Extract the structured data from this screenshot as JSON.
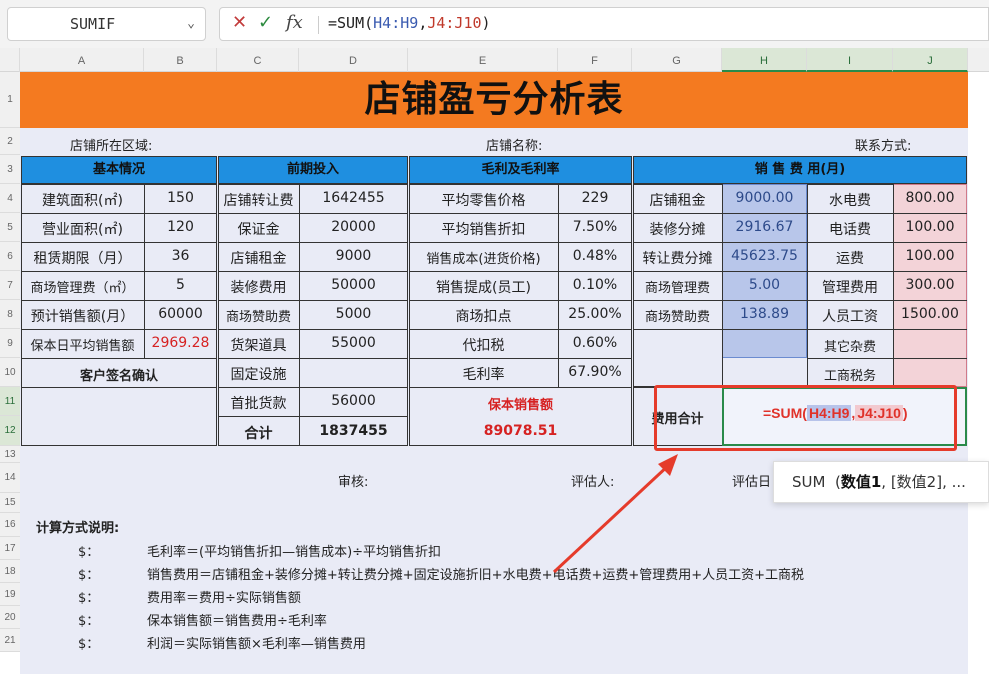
{
  "formula_bar": {
    "name_box": "SUMIF",
    "cancel_icon": "✕",
    "confirm_icon": "✓",
    "fx_label": "fx",
    "formula_prefix": "=SUM(",
    "formula_ref1": "H4:H9",
    "formula_comma": ",",
    "formula_ref2": "J4:J10",
    "formula_suffix": ")"
  },
  "columns": [
    "A",
    "B",
    "C",
    "D",
    "E",
    "F",
    "G",
    "H",
    "I",
    "J"
  ],
  "rows": [
    "1",
    "2",
    "3",
    "4",
    "5",
    "6",
    "7",
    "8",
    "9",
    "10",
    "11",
    "12",
    "13",
    "14",
    "15",
    "16",
    "17",
    "18",
    "19",
    "20",
    "21"
  ],
  "sheet": {
    "title": "店铺盈亏分析表",
    "region_label": "店铺所在区域:",
    "store_name_label": "店铺名称:",
    "contact_label": "联系方式:",
    "sections": {
      "basic": "基本情况",
      "early": "前期投入",
      "margin": "毛利及毛利率",
      "sales_cost": "销 售 费 用(月)"
    },
    "basic_rows": [
      {
        "label": "建筑面积(㎡)",
        "value": "150"
      },
      {
        "label": "营业面积(㎡)",
        "value": "120"
      },
      {
        "label": "租赁期限（月）",
        "value": "36"
      },
      {
        "label": "商场管理费（㎡）",
        "value": "5"
      },
      {
        "label": "预计销售额(月）",
        "value": "60000"
      },
      {
        "label": "保本日平均销售额",
        "value": "2969.28"
      }
    ],
    "customer_sign": "客户签名确认",
    "early_rows": [
      {
        "label": "店铺转让费",
        "value": "1642455"
      },
      {
        "label": "保证金",
        "value": "20000"
      },
      {
        "label": "店铺租金",
        "value": "9000"
      },
      {
        "label": "装修费用",
        "value": "50000"
      },
      {
        "label": "商场赞助费",
        "value": "5000"
      },
      {
        "label": "货架道具",
        "value": "55000"
      },
      {
        "label": "固定设施",
        "value": ""
      },
      {
        "label": "首批货款",
        "value": "56000"
      },
      {
        "label": "合计",
        "value": "1837455"
      }
    ],
    "margin_rows": [
      {
        "label": "平均零售价格",
        "value": "229"
      },
      {
        "label": "平均销售折扣",
        "value": "7.50%"
      },
      {
        "label": "销售成本(进货价格)",
        "value": "0.48%"
      },
      {
        "label": "销售提成(员工)",
        "value": "0.10%"
      },
      {
        "label": "商场扣点",
        "value": "25.00%"
      },
      {
        "label": "代扣税",
        "value": "0.60%"
      },
      {
        "label": "毛利率",
        "value": "67.90%"
      }
    ],
    "break_even_label": "保本销售额",
    "break_even_value": "89078.51",
    "sales_left": [
      {
        "label": "店铺租金",
        "value": "9000.00"
      },
      {
        "label": "装修分摊",
        "value": "2916.67"
      },
      {
        "label": "转让费分摊",
        "value": "45623.75"
      },
      {
        "label": "商场管理费",
        "value": "5.00"
      },
      {
        "label": "商场赞助费",
        "value": "138.89"
      }
    ],
    "sales_right": [
      {
        "label": "水电费",
        "value": "800.00"
      },
      {
        "label": "电话费",
        "value": "100.00"
      },
      {
        "label": "运费",
        "value": "100.00"
      },
      {
        "label": "管理费用",
        "value": "300.00"
      },
      {
        "label": "人员工资",
        "value": "1500.00"
      },
      {
        "label": "其它杂费",
        "value": ""
      },
      {
        "label": "工商税务",
        "value": ""
      }
    ],
    "cost_total_label": "费用合计",
    "edit_formula": {
      "prefix": "=SUM(",
      "ref1": "H4:H9",
      "comma": ",",
      "ref2": "J4:J10",
      "suffix": ")"
    },
    "audit_label": "审核:",
    "assessor_label": "评估人:",
    "assess_date_label": "评估日",
    "notes_title": "计算方式说明:",
    "notes": [
      {
        "mark": "$：",
        "text": "毛利率＝(平均销售折扣—销售成本)÷平均销售折扣"
      },
      {
        "mark": "$：",
        "text": "销售费用＝店铺租金+装修分摊+转让费分摊+固定设施折旧+水电费+电话费+运费+管理费用+人员工资+工商税"
      },
      {
        "mark": "$：",
        "text": "费用率＝费用÷实际销售额"
      },
      {
        "mark": "$：",
        "text": "保本销售额＝销售费用÷毛利率"
      },
      {
        "mark": "$：",
        "text": "利润＝实际销售额×毛利率—销售费用"
      }
    ]
  },
  "tooltip": {
    "fn": "SUM",
    "arg1": "数值1",
    "rest": ", [数值2], ..."
  },
  "colors": {
    "title_bg": "#f47a20",
    "header_blue": "#1f8fe0",
    "red": "#d62222",
    "annotation": "#e53b2b"
  }
}
